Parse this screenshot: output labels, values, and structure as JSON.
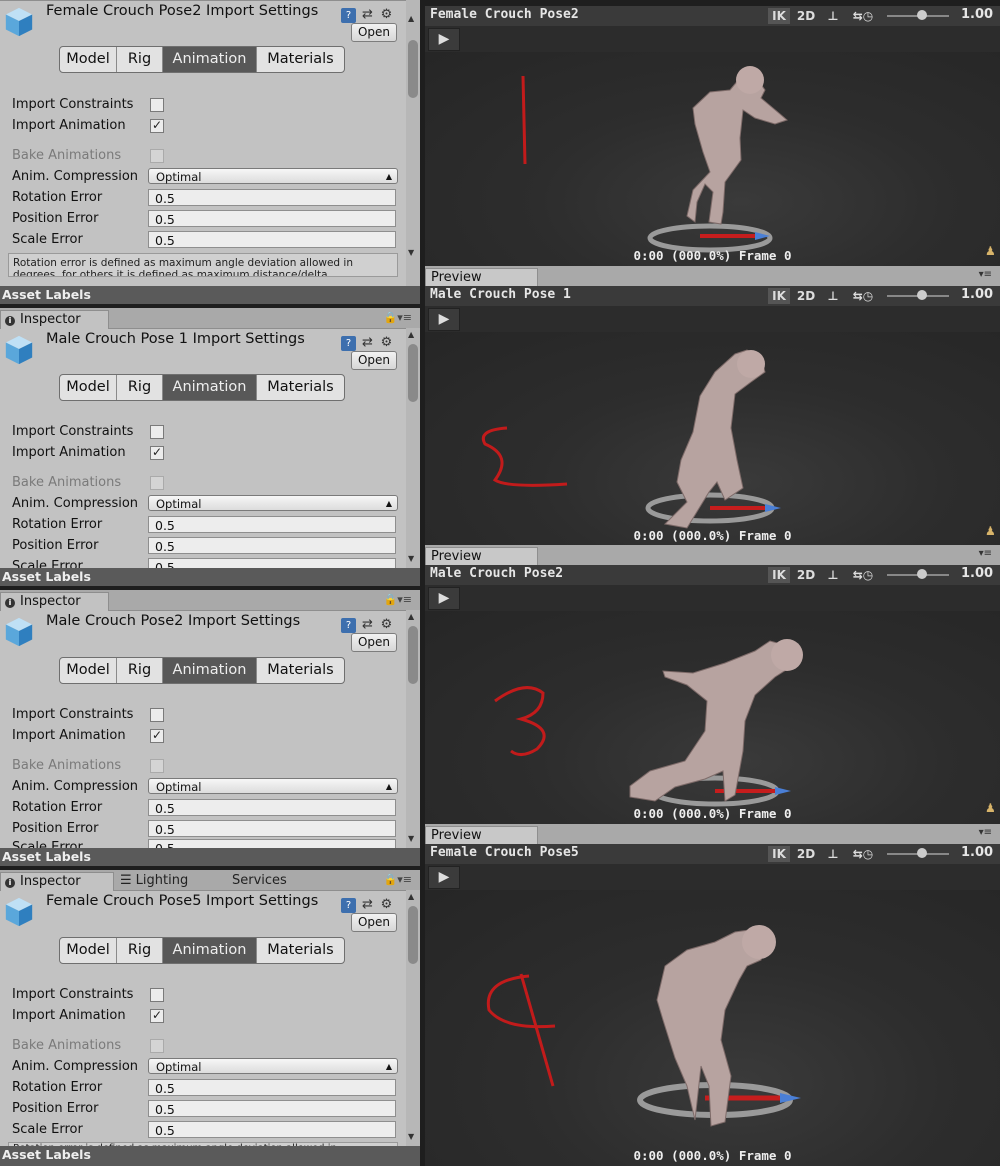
{
  "common": {
    "inspector_tab": "Inspector",
    "open_button": "Open",
    "tabs": [
      "Model",
      "Rig",
      "Animation",
      "Materials"
    ],
    "import_constraints": "Import Constraints",
    "import_animation": "Import Animation",
    "bake_animations": "Bake Animations",
    "anim_compression": "Anim. Compression",
    "anim_compression_value": "Optimal",
    "rotation_error": "Rotation Error",
    "position_error": "Position Error",
    "scale_error": "Scale Error",
    "error_value": "0.5",
    "asset_labels": "Asset Labels",
    "preview_tab": "Preview",
    "ik_label": "IK",
    "mode_2d": "2D",
    "speed": "1.00",
    "frame_readout": "0:00 (000.0%) Frame 0"
  },
  "panels": [
    {
      "asset_title": "Female Crouch Pose2 Import Settings",
      "preview_name": "Female Crouch Pose2",
      "help_text": "Rotation error is defined as maximum angle deviation allowed in degrees, for others it is defined as maximum distance/delta",
      "handwritten_number": "1"
    },
    {
      "asset_title": "Male Crouch Pose 1 Import Settings",
      "preview_name": "Male Crouch Pose 1",
      "handwritten_number": "2"
    },
    {
      "asset_title": "Male Crouch Pose2 Import Settings",
      "preview_name": "Male Crouch Pose2",
      "handwritten_number": "3"
    },
    {
      "asset_title": "Female Crouch Pose5 Import Settings",
      "preview_name": "Female Crouch Pose5",
      "extra_tabs": [
        "Lighting",
        "Services"
      ],
      "help_text": "Rotation error is defined as maximum angle deviation allowed in",
      "handwritten_number": "4"
    }
  ],
  "colors": {
    "handwriting": "#c21b1b",
    "inspector_bg": "#c2c2c2",
    "active_tab": "#585858",
    "viewport_bg": "#2d2d2d"
  }
}
